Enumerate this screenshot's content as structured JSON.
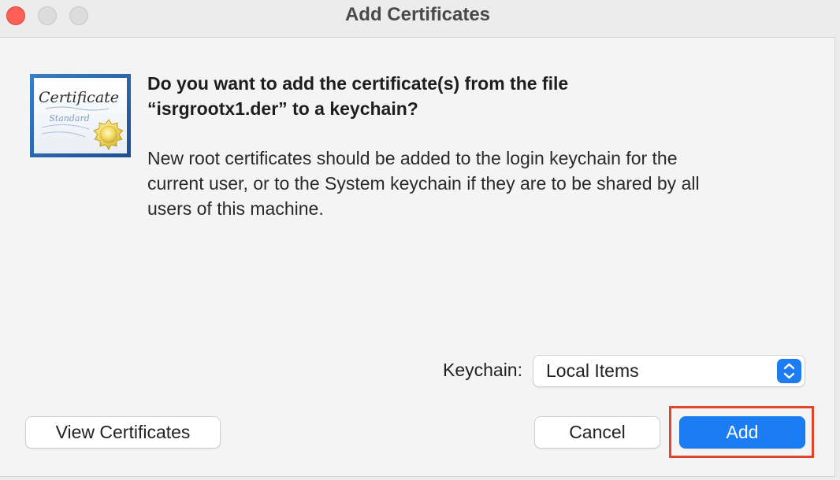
{
  "window": {
    "title": "Add Certificates"
  },
  "dialog": {
    "heading_line1": "Do you want to add the certificate(s) from the file",
    "heading_line2": "“isrgrootx1.der” to a keychain?",
    "body_line1": "New root certificates should be added to the login keychain for the",
    "body_line2": "current user, or to the System keychain if they are to be shared by all",
    "body_line3": "users of this machine.",
    "icon_text_main": "Certificate",
    "icon_text_sub": "Standard"
  },
  "keychain": {
    "label": "Keychain:",
    "selected": "Local Items"
  },
  "buttons": {
    "view_certificates": "View Certificates",
    "cancel": "Cancel",
    "add": "Add"
  },
  "colors": {
    "accent": "#1a7df3",
    "close": "#fe5f57",
    "highlight": "#e1452d"
  }
}
